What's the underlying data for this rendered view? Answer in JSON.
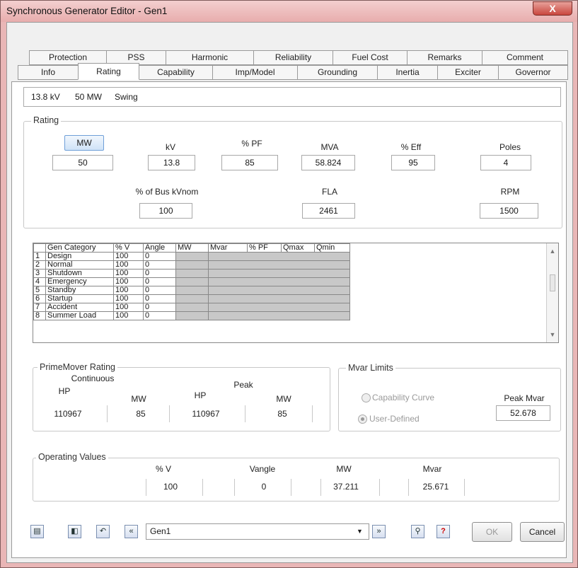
{
  "window": {
    "title": "Synchronous Generator Editor - Gen1",
    "close": "X"
  },
  "tabs_row1": [
    "Protection",
    "PSS",
    "Harmonic",
    "Reliability",
    "Fuel Cost",
    "Remarks",
    "Comment"
  ],
  "tabs_row2": [
    "Info",
    "Rating",
    "Capability",
    "Imp/Model",
    "Grounding",
    "Inertia",
    "Exciter",
    "Governor"
  ],
  "header": {
    "kv": "13.8 kV",
    "mw": "50 MW",
    "mode": "Swing"
  },
  "rating": {
    "title": "Rating",
    "mw_button": "MW",
    "labels": {
      "kv": "kV",
      "pf": "% PF",
      "mva": "MVA",
      "eff": "% Eff",
      "poles": "Poles",
      "bus_kv": "% of Bus kVnom",
      "fla": "FLA",
      "rpm": "RPM"
    },
    "values": {
      "mw": "50",
      "kv": "13.8",
      "pf": "85",
      "mva": "58.824",
      "eff": "95",
      "poles": "4",
      "bus_kv": "100",
      "fla": "2461",
      "rpm": "1500"
    }
  },
  "grid": {
    "columns": [
      "Gen Category",
      "% V",
      "Angle",
      "MW",
      "Mvar",
      "% PF",
      "Qmax",
      "Qmin"
    ],
    "rows": [
      [
        "1",
        "Design",
        "100",
        "0"
      ],
      [
        "2",
        "Normal",
        "100",
        "0"
      ],
      [
        "3",
        "Shutdown",
        "100",
        "0"
      ],
      [
        "4",
        "Emergency",
        "100",
        "0"
      ],
      [
        "5",
        "Standby",
        "100",
        "0"
      ],
      [
        "6",
        "Startup",
        "100",
        "0"
      ],
      [
        "7",
        "Accident",
        "100",
        "0"
      ],
      [
        "8",
        "Summer Load",
        "100",
        "0"
      ]
    ]
  },
  "prime": {
    "title": "PrimeMover Rating",
    "continuous": "Continuous",
    "peak": "Peak",
    "hp": "HP",
    "mw": "MW",
    "cont_hp": "110967",
    "cont_mw": "85",
    "peak_hp": "110967",
    "peak_mw": "85"
  },
  "mvar": {
    "title": "Mvar Limits",
    "capability": "Capability Curve",
    "user": "User-Defined",
    "peak_label": "Peak Mvar",
    "peak_value": "52.678"
  },
  "operating": {
    "title": "Operating Values",
    "v_label": "% V",
    "angle_label": "Vangle",
    "mw_label": "MW",
    "mvar_label": "Mvar",
    "v": "100",
    "angle": "0",
    "mw": "37.211",
    "mvar": "25.671"
  },
  "footer": {
    "combo": "Gen1",
    "ok": "OK",
    "cancel": "Cancel"
  }
}
